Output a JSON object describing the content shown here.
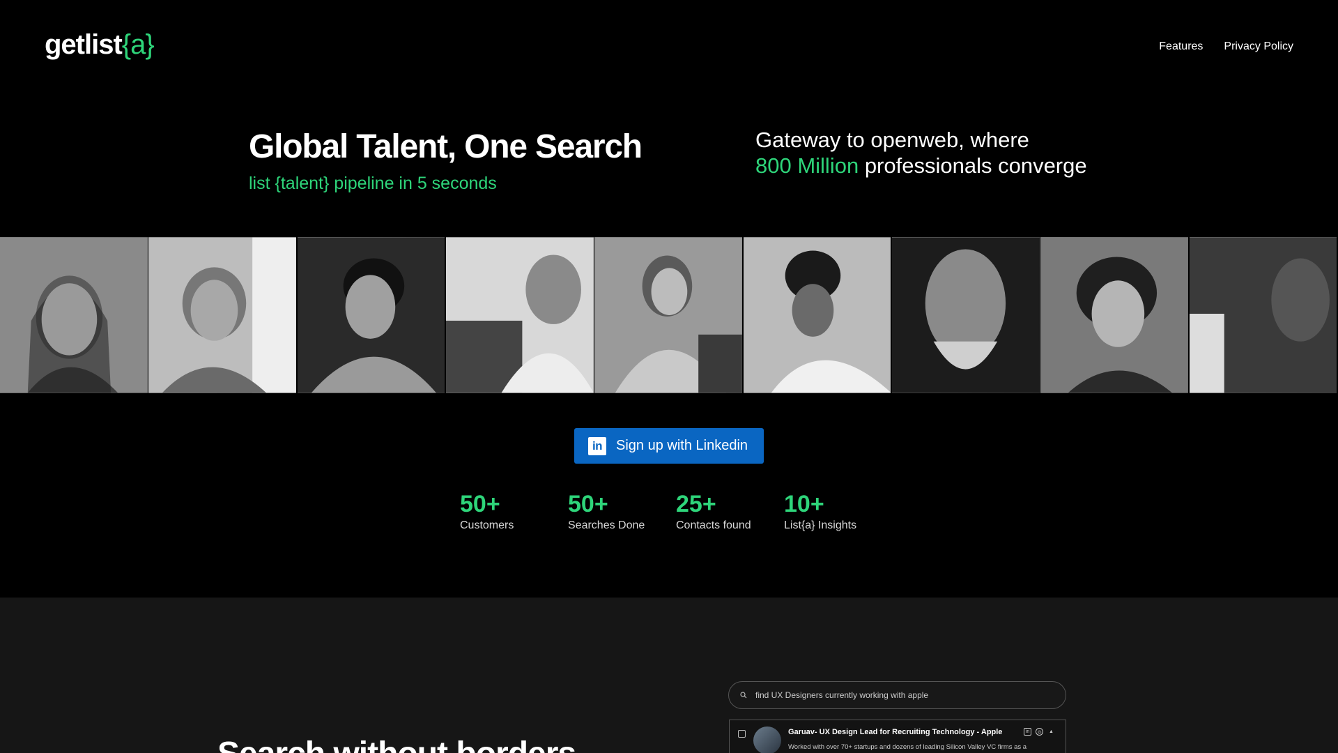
{
  "brand": {
    "name": "getlist",
    "suffix": "{a}",
    "accent": "#2ed57a"
  },
  "nav": {
    "features": "Features",
    "privacy": "Privacy Policy"
  },
  "hero": {
    "title": "Global Talent, One Search",
    "subtitle": "list {talent} pipeline in 5 seconds",
    "gateway_line1": "Gateway to openweb, where",
    "gateway_highlight": "800 Million",
    "gateway_line2": " professionals converge"
  },
  "photos": {
    "count_note": "grayscale portrait strip",
    "items": [
      "portrait-1",
      "portrait-2",
      "portrait-3",
      "portrait-4",
      "portrait-5",
      "portrait-6",
      "portrait-7",
      "portrait-8",
      "portrait-9"
    ]
  },
  "cta": {
    "icon_text": "in",
    "label": "Sign up with Linkedin",
    "color": "#0a66c2"
  },
  "stats": [
    {
      "value": "50+",
      "label": "Customers"
    },
    {
      "value": "50+",
      "label": "Searches Done"
    },
    {
      "value": "25+",
      "label": "Contacts found"
    },
    {
      "value": "10+",
      "label": "List{a} Insights"
    }
  ],
  "lower": {
    "title": "Search without borders",
    "search_placeholder": "find UX Designers currently working with apple",
    "result": {
      "title": "Garuav- UX Design Lead for Recruiting Technology - Apple",
      "description": "Worked with over 70+ startups and dozens of leading Silicon Valley VC firms as a"
    }
  }
}
